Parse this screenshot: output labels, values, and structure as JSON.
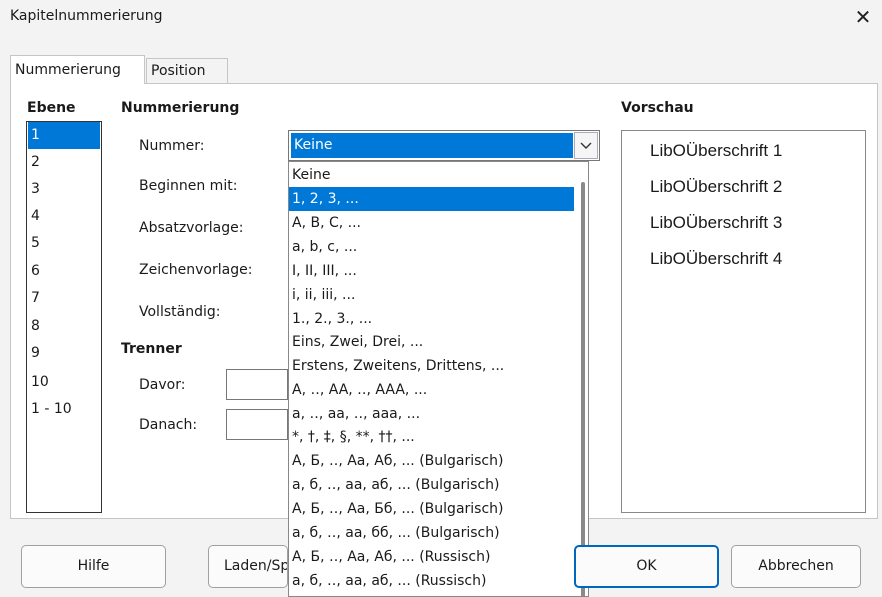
{
  "window": {
    "title": "Kapitelnummerierung",
    "close_glyph": "✕"
  },
  "tabs": [
    {
      "label": "Nummerierung",
      "active": true
    },
    {
      "label": "Position",
      "active": false
    }
  ],
  "level": {
    "heading": "Ebene",
    "items": [
      "1",
      "2",
      "3",
      "4",
      "5",
      "6",
      "7",
      "8",
      "9",
      "10",
      "1 - 10"
    ],
    "selected": "1"
  },
  "numbering": {
    "heading": "Nummerierung",
    "number_label": "Nummer:",
    "start_label": "Beginnen mit:",
    "para_style_label": "Absatzvorlage:",
    "char_style_label": "Zeichenvorlage:",
    "complete_label": "Vollständig:",
    "selected_value": "Keine"
  },
  "separator": {
    "heading": "Trenner",
    "before_label": "Davor:",
    "after_label": "Danach:"
  },
  "dropdown": {
    "options": [
      "Keine",
      "1, 2, 3, ...",
      "A, B, C, ...",
      "a, b, c, ...",
      "I, II, III, ...",
      "i, ii, iii, ...",
      "1., 2., 3., ...",
      "Eins, Zwei, Drei, ...",
      "Erstens, Zweitens, Drittens, ...",
      "A, ‥, AA, ‥, AAA, ...",
      "a, ‥, aa, ‥, aaa, ...",
      "*, †, ‡, §, **, ††, ...",
      "А, Б, ‥, Аа, Аб, ... (Bulgarisch)",
      "а, б, ‥, аа, аб, ... (Bulgarisch)",
      "А, Б, ‥, Аа, Бб, ... (Bulgarisch)",
      "а, б, ‥, аа, бб, ... (Bulgarisch)",
      "А, Б, ‥, Аа, Аб, ... (Russisch)",
      "а, б, ‥, аа, аб, ... (Russisch)"
    ],
    "highlighted": "1, 2, 3, ..."
  },
  "preview": {
    "heading": "Vorschau",
    "lines": [
      "LibOÜberschrift 1",
      "LibOÜberschrift 2",
      "LibOÜberschrift 3",
      "LibOÜberschrift 4"
    ]
  },
  "buttons": {
    "help": "Hilfe",
    "load_save": "Laden/Speichern",
    "ok": "OK",
    "cancel": "Abbrechen"
  },
  "colors": {
    "accent": "#0078d7",
    "ok_border": "#0067c0"
  }
}
